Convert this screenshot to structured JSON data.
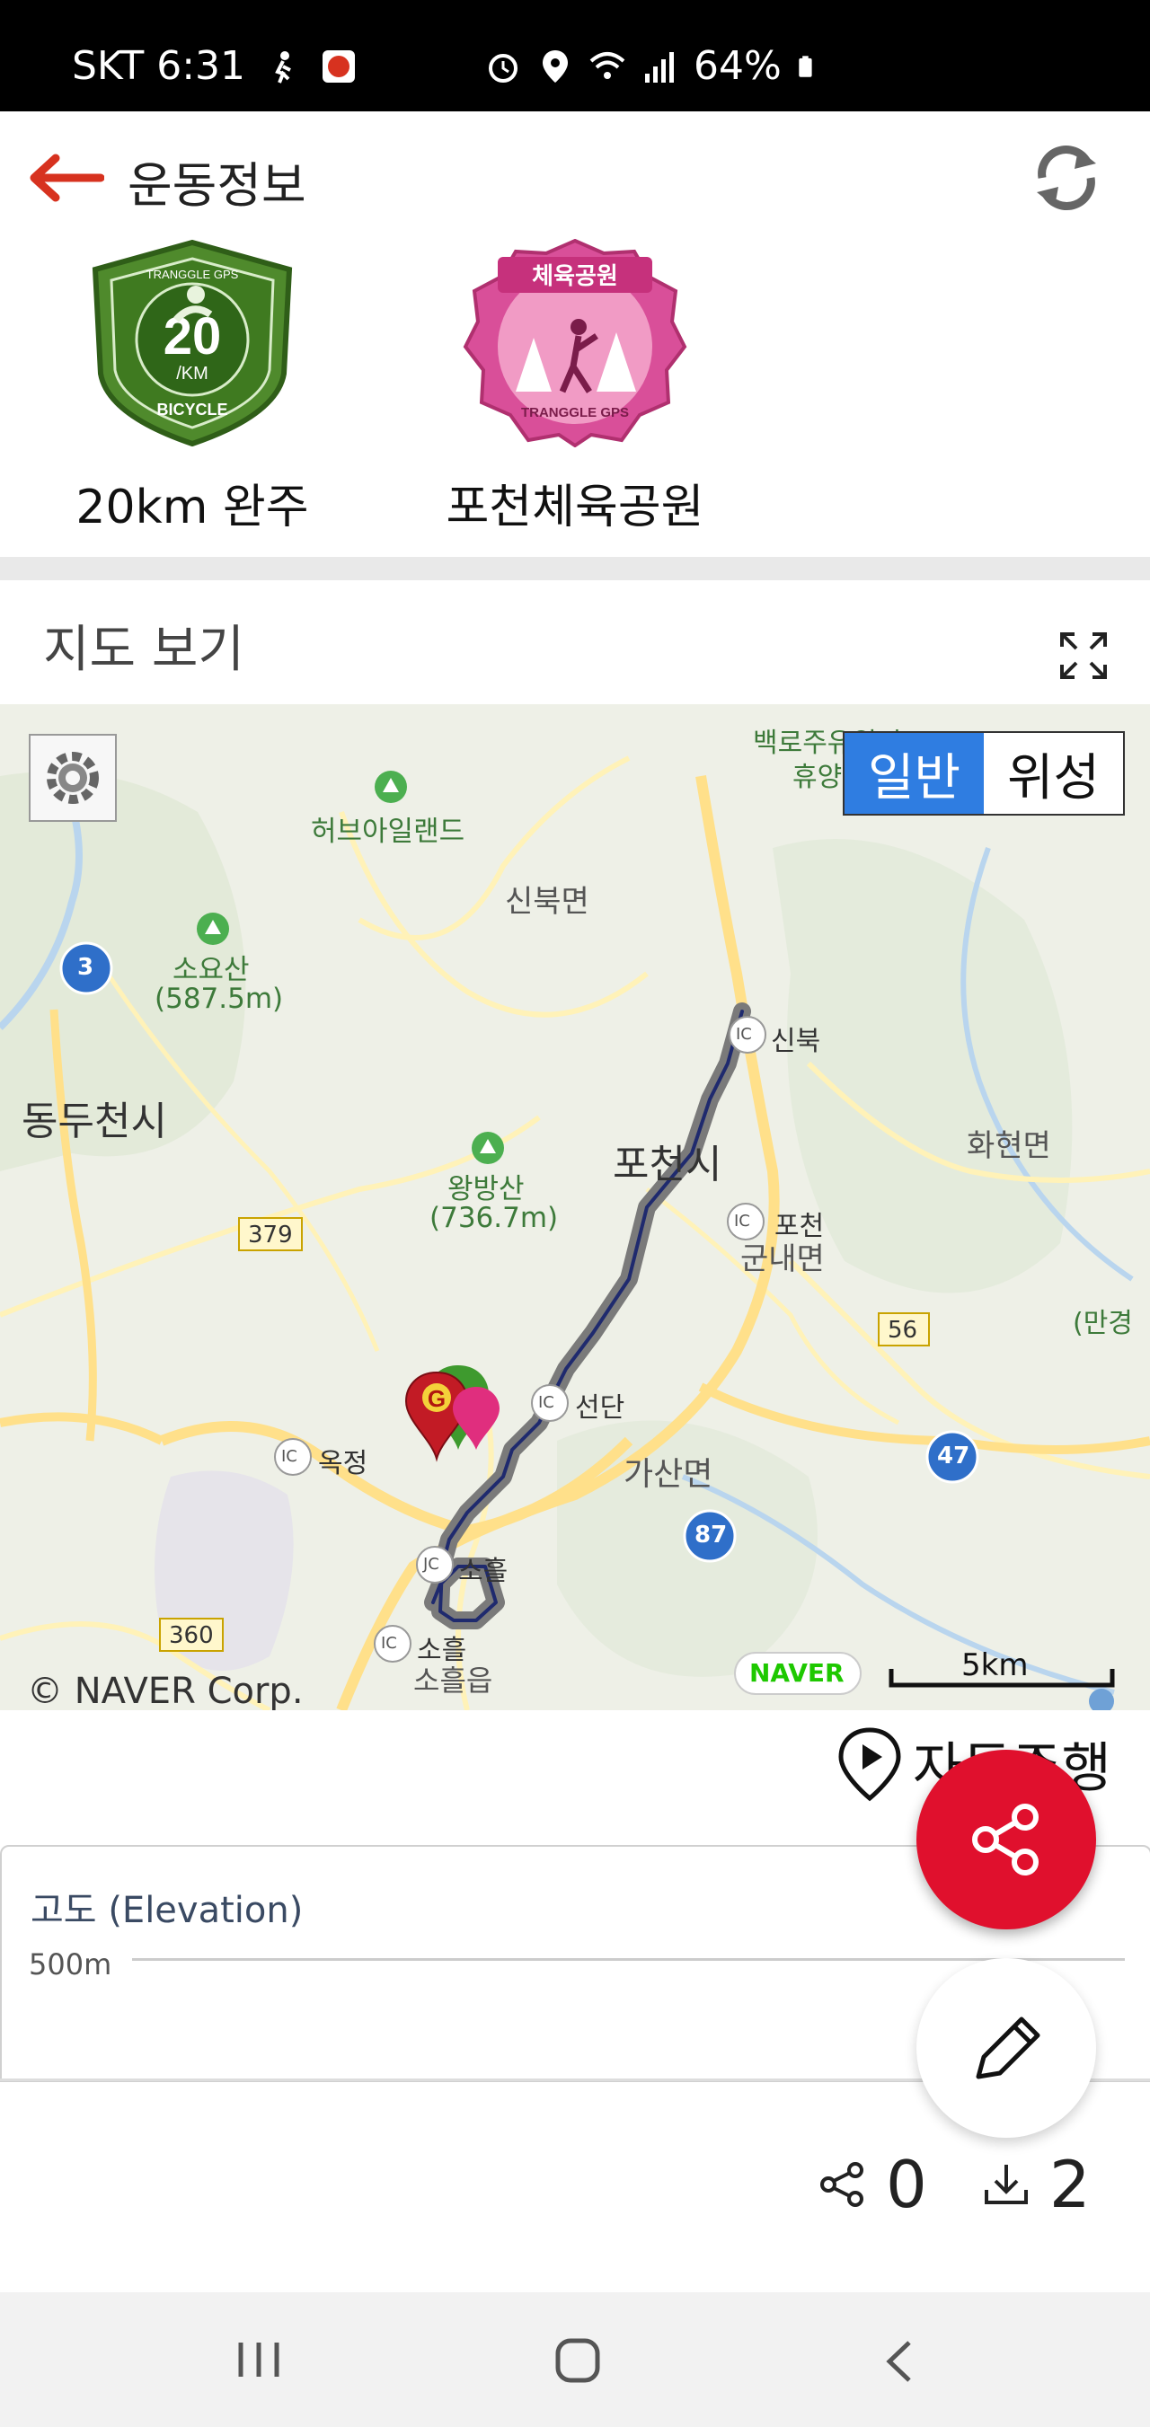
{
  "status_bar": {
    "carrier_time": "SKT 6:31",
    "battery": "64%",
    "icons": [
      "walk-icon",
      "app-icon",
      "alarm-icon",
      "location-icon",
      "wifi-icon",
      "signal-icon",
      "battery-icon"
    ]
  },
  "header": {
    "title": "운동정보",
    "back_icon": "back-arrow-icon",
    "refresh_icon": "refresh-icon",
    "accent": "#d7321f"
  },
  "badges": [
    {
      "label": "20km 완주",
      "badge_top": "TRANGGLE GPS",
      "badge_number": "20",
      "badge_unit": "/KM",
      "badge_bottom": "BICYCLE"
    },
    {
      "label": "포천체육공원",
      "badge_top": "체육공원",
      "badge_bottom": "TRANGGLE GPS"
    }
  ],
  "map_section": {
    "title": "지도 보기",
    "toggle": {
      "selected": "일반",
      "other": "위성",
      "selected_color": "#2f7de1"
    },
    "labels": {
      "herbisland": "허브아일랜드",
      "sinbuk_myeon": "신북면",
      "soyosan": "소요산",
      "soyosan_h": "(587.5m)",
      "dongducheon": "동두천시",
      "pocheon": "포천시",
      "wangbangsan": "왕방산",
      "wangbangsan_h": "(736.7m)",
      "hwahyeon": "화현면",
      "sinbuk_ic": "신북",
      "pocheon_ic": "포천",
      "gunnae": "군내면",
      "seondan": "선단",
      "gasan": "가산면",
      "okjeong": "옥정",
      "soheul_jc": "소흘",
      "soheul_ic": "소흘",
      "soheul_eup": "소흘읍",
      "baekro": "백로주유원지",
      "hyuyang": "휴양",
      "mangyeong": "(만경",
      "ic": "IC",
      "jc": "JC",
      "road_3": "3",
      "road_379": "379",
      "road_56": "56",
      "road_47": "47",
      "road_87": "87",
      "road_360": "360",
      "naver_logo": "NAVER",
      "scale": "5km",
      "copyright": "© NAVER Corp."
    }
  },
  "autoplay": {
    "label": "자동주행",
    "icon": "play-location-icon"
  },
  "elevation": {
    "title": "고도 (Elevation)",
    "tick": "500m"
  },
  "stats": {
    "shares": "0",
    "downloads": "2"
  },
  "nav": {
    "icons": [
      "recent-apps-icon",
      "home-icon",
      "back-icon"
    ]
  }
}
